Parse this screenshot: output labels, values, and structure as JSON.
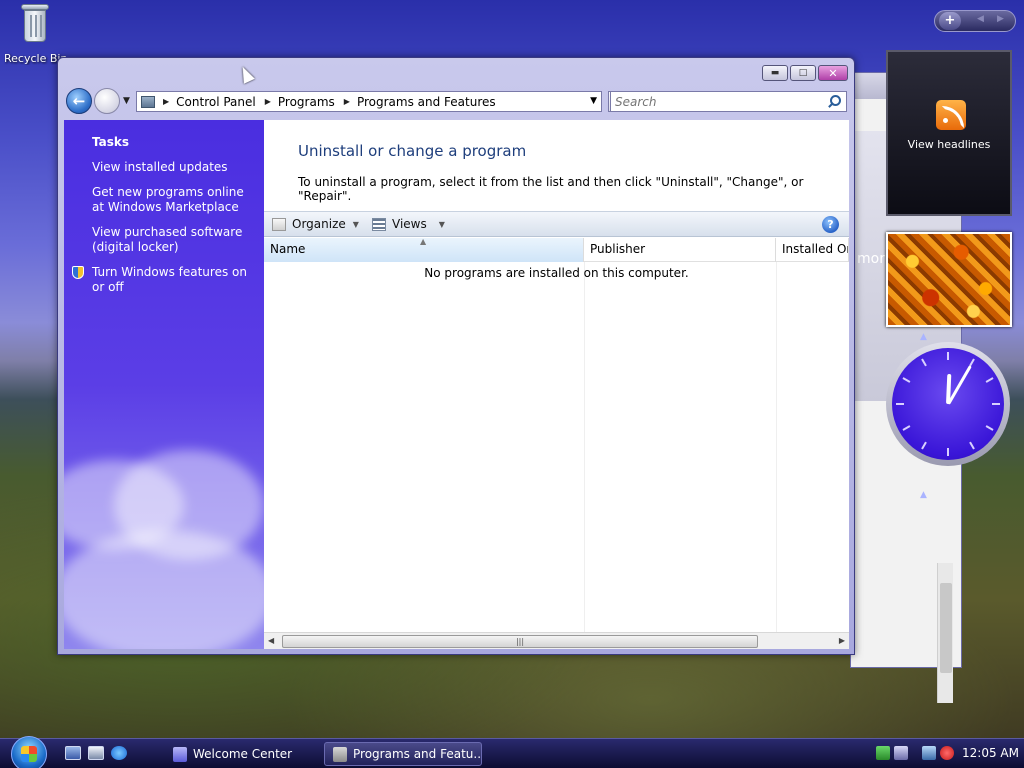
{
  "desktop": {
    "recycle_bin_label": "Recycle Bin"
  },
  "window": {
    "address": [
      "Control Panel",
      "Programs",
      "Programs and Features"
    ],
    "search_placeholder": "Search",
    "tasks": {
      "title": "Tasks",
      "items": [
        "View installed updates",
        "Get new programs online at Windows Marketplace",
        "View purchased software (digital locker)",
        "Turn Windows features on or off"
      ]
    },
    "heading": "Uninstall or change a program",
    "description": "To uninstall a program, select it from the list and then click \"Uninstall\", \"Change\", or \"Repair\".",
    "toolbar": {
      "organize": "Organize",
      "views": "Views",
      "help": "?"
    },
    "columns": [
      "Name",
      "Publisher",
      "Installed On"
    ],
    "empty_message": "No programs are installed on this computer."
  },
  "back_window": {
    "partial_text": "mor"
  },
  "gadgets": {
    "feed_label": "View headlines",
    "clock": {
      "hour": 12,
      "minute": 5
    }
  },
  "taskbar": {
    "buttons": [
      "Welcome Center",
      "Programs and Featu..."
    ],
    "active_index": 1,
    "time": "12:05 AM"
  },
  "colors": {
    "task_pane": "#4a2ee0",
    "heading": "#1e3e7c",
    "taskbar": "#0c0c32"
  }
}
